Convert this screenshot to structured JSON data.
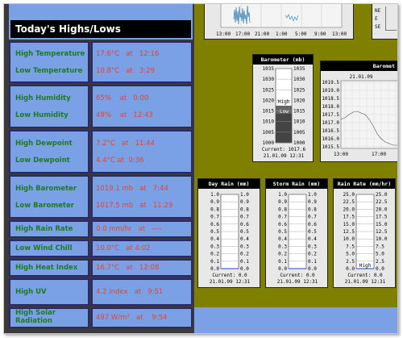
{
  "highs_lows": {
    "title": "Today's Highs/Lows",
    "rows": [
      {
        "label": "High Temperature",
        "value": "17.6°C   at   12:16"
      },
      {
        "label": "Low Temperature",
        "value": "10.8°C   at   3:29"
      },
      {
        "label": "High Humidity",
        "value": "65%    at   0:00"
      },
      {
        "label": "Low Humidity",
        "value": "49%    at   12:43"
      },
      {
        "label": "High Dewpoint",
        "value": "7.2°C   at   11:44"
      },
      {
        "label": "Low Dewpoint",
        "value": "4.4°C at  0:36"
      },
      {
        "label": "High Barometer",
        "value": "1019.1 mb   at   7:44"
      },
      {
        "label": "Low Barometer",
        "value": "1017.5 mb   at   11:29"
      },
      {
        "label": "High Rain Rate",
        "value": "0.0 mm/hr   at   ----"
      },
      {
        "label": "Low Wind Chill",
        "value": "10.0°C   at 4:02"
      },
      {
        "label": "High Heat Index",
        "value": "16.7°C   at   12:08"
      },
      {
        "label": "High UV",
        "value": "4.2 index   at   9:51"
      },
      {
        "label": "High Solar Radiation",
        "value": "497 W/m²   at    9:54"
      }
    ]
  },
  "top_chart": {
    "x_ticks": [
      "13:00",
      "17:00",
      "21:00",
      "1:00",
      "5:00",
      "9:00",
      "13:00"
    ]
  },
  "top_right_labels": [
    "NE",
    "E",
    "SE"
  ],
  "barometer": {
    "title": "Barometer (mb)",
    "ticks": [
      "1035",
      "1030",
      "1025",
      "1020",
      "1015",
      "1010",
      "1005",
      "1000"
    ],
    "high_label": "High",
    "low_label": "Low",
    "current": "Current: 1017.6",
    "timestamp": "21.01.09 12:31"
  },
  "baro_chart": {
    "title": "Baromet",
    "date": "21.01.09",
    "y_ticks": [
      "1019.5",
      "1019.0",
      "1018.5",
      "1018.0",
      "1017.5",
      "1017.0",
      "1016.5",
      "1016.0",
      "1015.5"
    ],
    "x_ticks": [
      "13:00",
      "17:00"
    ]
  },
  "rain_gauges": [
    {
      "title": "Day Rain (mm)",
      "ticks": [
        "1.0",
        "0.9",
        "0.8",
        "0.7",
        "0.6",
        "0.5",
        "0.4",
        "0.3",
        "0.2",
        "0.1",
        "0.0"
      ],
      "current": "Current: 0.0",
      "timestamp": "21.01.09 12:31",
      "marker": ""
    },
    {
      "title": "Storm Rain (mm)",
      "ticks": [
        "1.0",
        "0.9",
        "0.8",
        "0.7",
        "0.6",
        "0.5",
        "0.4",
        "0.3",
        "0.2",
        "0.1",
        "0.0"
      ],
      "current": "Current: 0.0",
      "timestamp": "21.01.09 12:31",
      "marker": ""
    },
    {
      "title": "Rain Rate (mm/hr)",
      "ticks": [
        "25.0",
        "22.5",
        "20.0",
        "17.5",
        "15.0",
        "12.5",
        "10.0",
        "7.5",
        "5.0",
        "2.5",
        "0.0"
      ],
      "current": "Current: 0.0",
      "timestamp": "21.01.09 12:31",
      "marker": "High"
    }
  ]
}
